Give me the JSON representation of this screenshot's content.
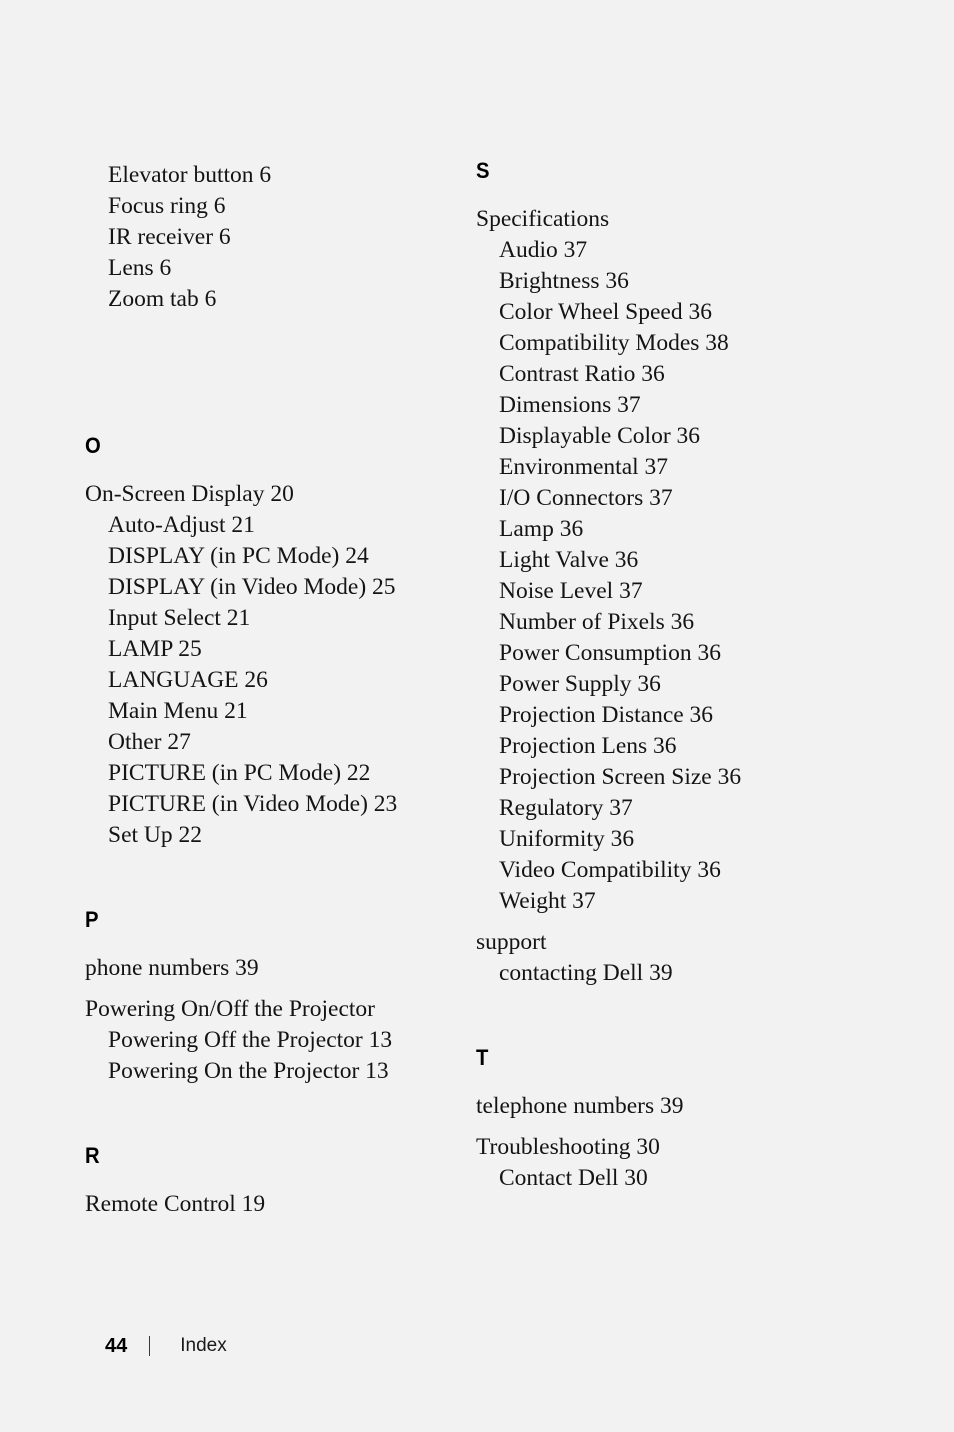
{
  "page": {
    "background_color": "#f2f2f2",
    "text_color": "#141414"
  },
  "footer": {
    "page_number": "44",
    "label": "Index"
  },
  "columns": {
    "left": {
      "continued_group": {
        "entries": [
          {
            "level": 2,
            "text": "Elevator button 6"
          },
          {
            "level": 2,
            "text": "Focus ring 6"
          },
          {
            "level": 2,
            "text": "IR receiver 6"
          },
          {
            "level": 2,
            "text": "Lens 6"
          },
          {
            "level": 2,
            "text": "Zoom tab 6"
          }
        ]
      },
      "sections": [
        {
          "letter": "O",
          "groups": [
            {
              "entries": [
                {
                  "level": 1,
                  "text": "On-Screen Display 20"
                },
                {
                  "level": 2,
                  "text": "Auto-Adjust 21"
                },
                {
                  "level": 2,
                  "text": "DISPLAY (in PC Mode) 24"
                },
                {
                  "level": 2,
                  "text": "DISPLAY (in Video Mode) 25"
                },
                {
                  "level": 2,
                  "text": "Input Select 21"
                },
                {
                  "level": 2,
                  "text": "LAMP 25"
                },
                {
                  "level": 2,
                  "text": "LANGUAGE 26"
                },
                {
                  "level": 2,
                  "text": "Main Menu 21"
                },
                {
                  "level": 2,
                  "text": "Other 27"
                },
                {
                  "level": 2,
                  "text": "PICTURE (in PC Mode) 22"
                },
                {
                  "level": 2,
                  "text": "PICTURE (in Video Mode) 23"
                },
                {
                  "level": 2,
                  "text": "Set Up 22"
                }
              ]
            }
          ]
        },
        {
          "letter": "P",
          "groups": [
            {
              "entries": [
                {
                  "level": 1,
                  "text": "phone numbers 39"
                }
              ]
            },
            {
              "entries": [
                {
                  "level": 1,
                  "text": "Powering On/Off the Projector"
                },
                {
                  "level": 2,
                  "text": "Powering Off the Projector 13"
                },
                {
                  "level": 2,
                  "text": "Powering On the Projector 13"
                }
              ]
            }
          ]
        },
        {
          "letter": "R",
          "groups": [
            {
              "entries": [
                {
                  "level": 1,
                  "text": "Remote Control 19"
                }
              ]
            }
          ]
        }
      ]
    },
    "right": {
      "sections": [
        {
          "letter": "S",
          "groups": [
            {
              "entries": [
                {
                  "level": 1,
                  "text": "Specifications"
                },
                {
                  "level": 2,
                  "text": "Audio 37"
                },
                {
                  "level": 2,
                  "text": "Brightness 36"
                },
                {
                  "level": 2,
                  "text": "Color Wheel Speed 36"
                },
                {
                  "level": 2,
                  "text": "Compatibility Modes 38"
                },
                {
                  "level": 2,
                  "text": "Contrast Ratio 36"
                },
                {
                  "level": 2,
                  "text": "Dimensions 37"
                },
                {
                  "level": 2,
                  "text": "Displayable Color 36"
                },
                {
                  "level": 2,
                  "text": "Environmental 37"
                },
                {
                  "level": 2,
                  "text": "I/O Connectors 37"
                },
                {
                  "level": 2,
                  "text": "Lamp 36"
                },
                {
                  "level": 2,
                  "text": "Light Valve 36"
                },
                {
                  "level": 2,
                  "text": "Noise Level 37"
                },
                {
                  "level": 2,
                  "text": "Number of Pixels 36"
                },
                {
                  "level": 2,
                  "text": "Power Consumption 36"
                },
                {
                  "level": 2,
                  "text": "Power Supply 36"
                },
                {
                  "level": 2,
                  "text": "Projection Distance 36"
                },
                {
                  "level": 2,
                  "text": "Projection Lens 36"
                },
                {
                  "level": 2,
                  "text": "Projection Screen Size 36"
                },
                {
                  "level": 2,
                  "text": "Regulatory 37"
                },
                {
                  "level": 2,
                  "text": "Uniformity 36"
                },
                {
                  "level": 2,
                  "text": "Video Compatibility 36"
                },
                {
                  "level": 2,
                  "text": "Weight 37"
                }
              ]
            },
            {
              "entries": [
                {
                  "level": 1,
                  "text": "support"
                },
                {
                  "level": 2,
                  "text": "contacting Dell 39"
                }
              ]
            }
          ]
        },
        {
          "letter": "T",
          "groups": [
            {
              "entries": [
                {
                  "level": 1,
                  "text": "telephone numbers 39"
                }
              ]
            },
            {
              "entries": [
                {
                  "level": 1,
                  "text": "Troubleshooting 30"
                },
                {
                  "level": 2,
                  "text": "Contact Dell 30"
                }
              ]
            }
          ]
        }
      ]
    }
  }
}
